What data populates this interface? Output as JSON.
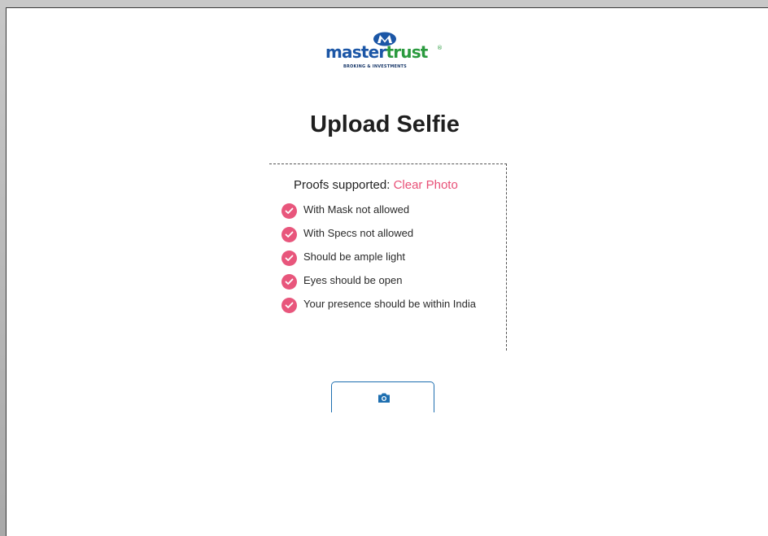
{
  "logo": {
    "brand_part1": "master",
    "brand_part2": "trust",
    "registered": "®",
    "tagline": "BROKING & INVESTMENTS"
  },
  "page": {
    "title": "Upload Selfie"
  },
  "proofs": {
    "heading_prefix": "Proofs supported: ",
    "heading_accent": "Clear Photo",
    "requirements": [
      "With Mask not allowed",
      "With Specs not allowed",
      "Should be ample light",
      "Eyes should be open",
      "Your presence should be within India"
    ]
  },
  "camera_button": {
    "icon": "camera-icon"
  },
  "colors": {
    "accent_pink": "#e85077",
    "brand_blue": "#1b56a6",
    "brand_green": "#2a9a3e",
    "button_border": "#1e6fb0"
  }
}
